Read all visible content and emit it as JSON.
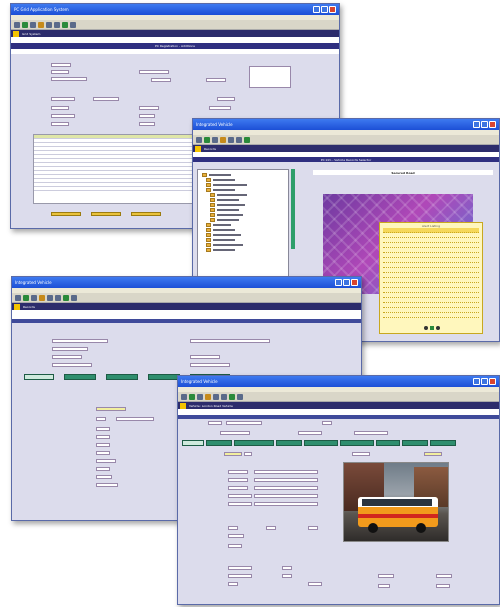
{
  "window1": {
    "title": "PC Grid Application System",
    "nav_label": "Grid System",
    "form_title": "PC Registration - Additions",
    "buttons": [
      "Save",
      "Clear",
      "Exit"
    ]
  },
  "window2": {
    "title": "Integrated Vehicle",
    "nav_label": "Records",
    "section_title": "PC Info - Vehicle Records Selector",
    "header_label": "Secured Road",
    "popup_title": "Alert Listing"
  },
  "window3": {
    "title": "Integrated Vehicle",
    "nav_label": "Records",
    "tabs": [
      "Driver details",
      "Vehicle Status",
      "Insurance",
      "Test Certificate",
      "Vehicle History Details"
    ]
  },
  "window4": {
    "title": "Integrated Vehicle",
    "nav_label": "Vehicle: London Road Vehicle",
    "tabs": [
      "General Details",
      "Driver Details",
      "Maintenance",
      "Insurance",
      "Certification",
      "Vehicle Costs",
      "Bus Stop",
      "Status",
      "Notes"
    ]
  },
  "icons": [
    "minimize-icon",
    "maximize-icon",
    "close-icon",
    "folder-icon",
    "toolbar-icon"
  ],
  "colors": {
    "titlebar": "#2a5fe0",
    "navbar": "#2c2c6c",
    "window_bg": "#dcdcec",
    "tab": "#2f8e6e",
    "popup": "#fff7bd"
  }
}
